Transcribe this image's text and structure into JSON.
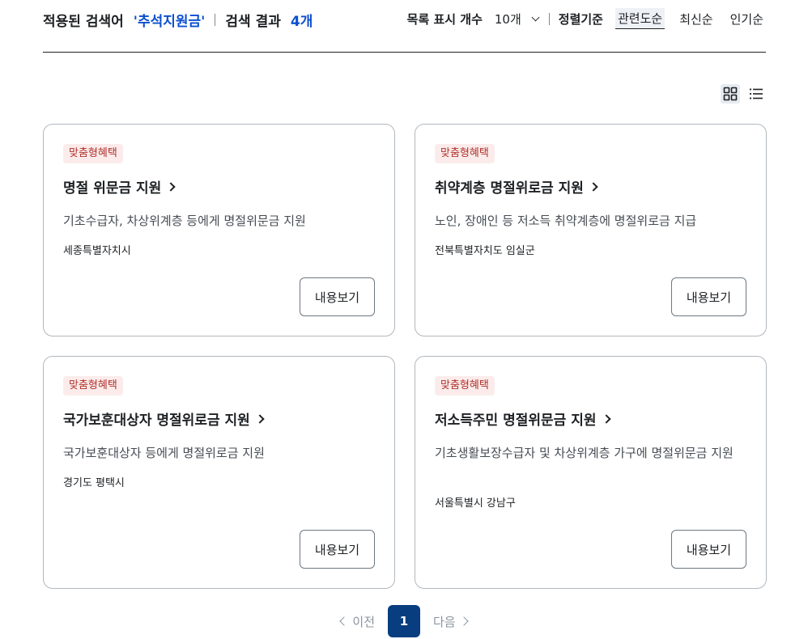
{
  "header": {
    "applied_label": "적용된 검색어",
    "keyword": "'추석지원금'",
    "result_label": "검색 결과",
    "result_count": "4개"
  },
  "controls": {
    "per_page_label": "목록 표시 개수",
    "per_page_value": "10개",
    "sort_label": "정렬기준",
    "sort_options": [
      "관련도순",
      "최신순",
      "인기순"
    ],
    "sort_selected": "관련도순"
  },
  "view_icons": [
    "grid-view-icon",
    "list-view-icon"
  ],
  "cards": [
    {
      "badge": "맞춤형혜택",
      "title": "명절 위문금 지원",
      "desc": "기초수급자, 차상위계층 등에게 명절위문금 지원",
      "region": "세종특별자치시",
      "button": "내용보기"
    },
    {
      "badge": "맞춤형혜택",
      "title": "취약계층 명절위로금 지원",
      "desc": "노인, 장애인 등 저소득 취약계층에 명절위로금 지급",
      "region": "전북특별자치도 임실군",
      "button": "내용보기"
    },
    {
      "badge": "맞춤형혜택",
      "title": "국가보훈대상자 명절위로금 지원",
      "desc": "국가보훈대상자 등에게 명절위로금 지원",
      "region": "경기도 평택시",
      "button": "내용보기"
    },
    {
      "badge": "맞춤형혜택",
      "title": "저소득주민 명절위문금 지원",
      "desc": "기초생활보장수급자 및 차상위계층 가구에 명절위문금 지원",
      "region": "서울특별시 강남구",
      "button": "내용보기"
    }
  ],
  "pagination": {
    "prev": "이전",
    "current": "1",
    "next": "다음"
  },
  "colors": {
    "accent": "#0b50d0",
    "badge_bg": "#fbeceb",
    "badge_text": "#b0312b",
    "page_active": "#083d7f"
  }
}
